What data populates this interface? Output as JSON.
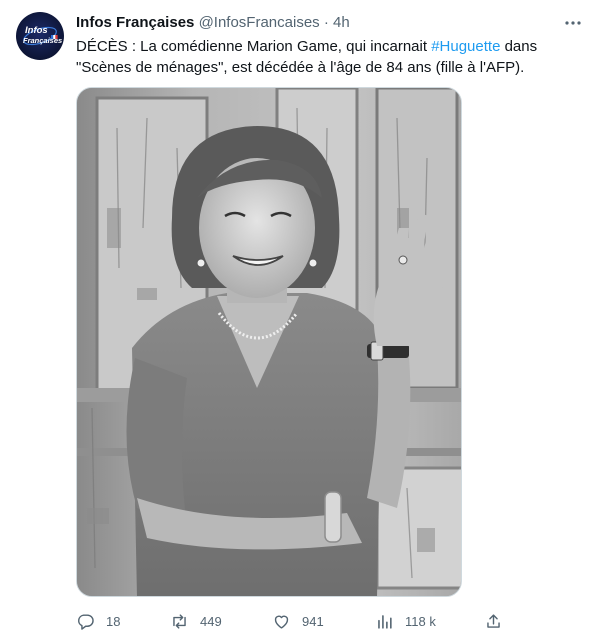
{
  "tweet": {
    "author_name": "Infos Françaises",
    "author_handle": "@InfosFrancaises",
    "separator": "·",
    "timestamp": "4h",
    "text_part1": "DÉCÈS : La comédienne Marion Game, qui incarnait ",
    "hashtag": "#Huguette",
    "text_part2": " dans \"Scènes de ménages\", est décédée à l'âge de 84 ans (fille à l'AFP).",
    "avatar_logo_line1": "Infos",
    "avatar_logo_line2": "Françaises"
  },
  "actions": {
    "replies": "18",
    "retweets": "449",
    "likes": "941",
    "views": "118 k"
  },
  "colors": {
    "text": "#0f1419",
    "secondary": "#536471",
    "accent": "#1d9bf0",
    "border": "#cfd9de"
  },
  "icons": [
    "more-icon",
    "reply-icon",
    "retweet-icon",
    "like-icon",
    "views-icon",
    "share-icon"
  ]
}
